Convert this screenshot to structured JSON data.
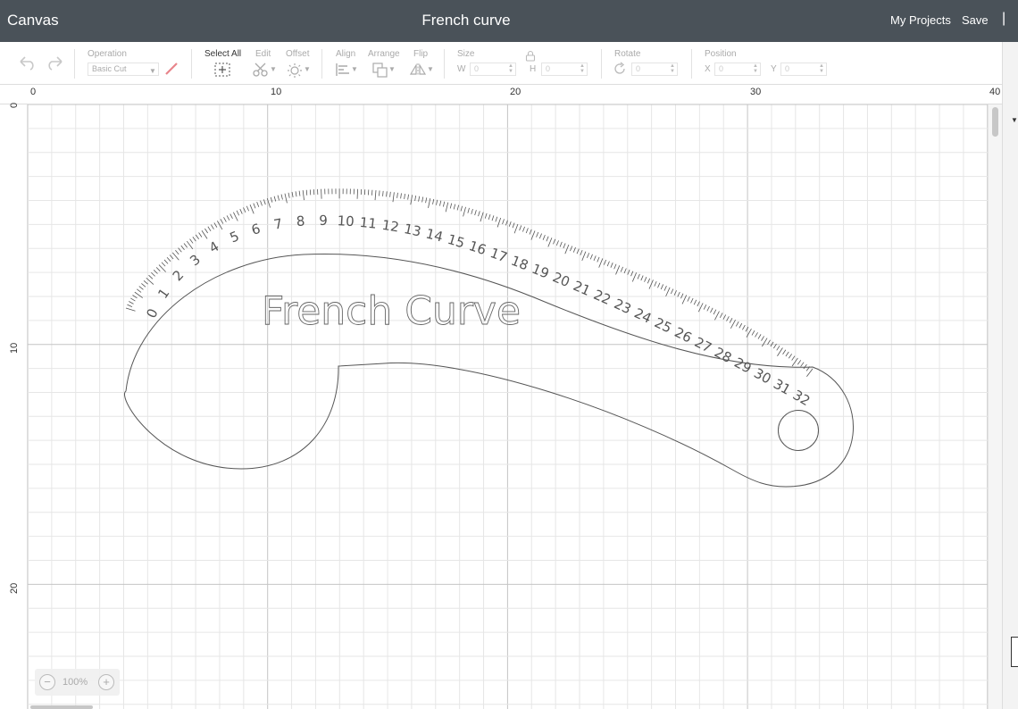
{
  "topbar": {
    "app_title": "Canvas",
    "document_title": "French curve",
    "my_projects": "My Projects",
    "save": "Save",
    "separator": "|"
  },
  "toolbar": {
    "operation_label": "Operation",
    "operation_value": "Basic Cut",
    "select_all_label": "Select All",
    "edit_label": "Edit",
    "offset_label": "Offset",
    "align_label": "Align",
    "arrange_label": "Arrange",
    "flip_label": "Flip",
    "size_label": "Size",
    "size_w_letter": "W",
    "size_w_value": "0",
    "size_h_letter": "H",
    "size_h_value": "0",
    "rotate_label": "Rotate",
    "rotate_value": "0",
    "position_label": "Position",
    "pos_x_letter": "X",
    "pos_x_value": "0",
    "pos_y_letter": "Y",
    "pos_y_value": "0"
  },
  "rulers": {
    "top": [
      "0",
      "10",
      "20",
      "30",
      "40"
    ],
    "left": [
      "0",
      "10",
      "20"
    ]
  },
  "design": {
    "text": "French Curve",
    "scale_numbers": [
      "0",
      "1",
      "2",
      "3",
      "4",
      "5",
      "6",
      "7",
      "8",
      "9",
      "10",
      "11",
      "12",
      "13",
      "14",
      "15",
      "16",
      "17",
      "18",
      "19",
      "20",
      "21",
      "22",
      "23",
      "24",
      "25",
      "26",
      "27",
      "28",
      "29",
      "30",
      "31",
      "32"
    ]
  },
  "zoom": {
    "minus": "−",
    "value": "100%",
    "plus": "+"
  },
  "colors": {
    "topbar_bg": "#4a5259",
    "operation_swatch": "#e8858b",
    "grid_minor": "#e6e6e6",
    "grid_major": "#c4c4c4",
    "shape_stroke": "#555555"
  }
}
